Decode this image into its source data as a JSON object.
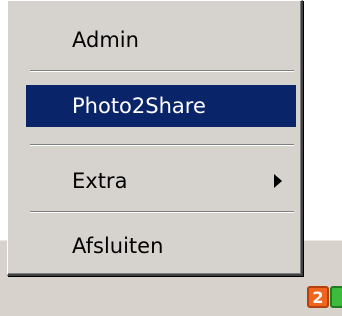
{
  "menu": {
    "items": [
      {
        "label": "Admin"
      },
      {
        "label": "Photo2Share",
        "selected": true
      },
      {
        "label": "Extra",
        "has_submenu": true,
        "submenu_icon": "chevron-right-icon"
      },
      {
        "label": "Afsluiten"
      }
    ]
  },
  "tray": {
    "icons": [
      {
        "name": "orange-tray-icon",
        "label": "2"
      },
      {
        "name": "green-tray-icon",
        "label": ""
      }
    ]
  },
  "colors": {
    "menu_background": "#d6d3ce",
    "selection_background": "#0a246a",
    "selection_text": "#ffffff",
    "taskbar": "#d7d3cc",
    "tray_orange": "#f0641e",
    "tray_green": "#3dbb3d"
  }
}
